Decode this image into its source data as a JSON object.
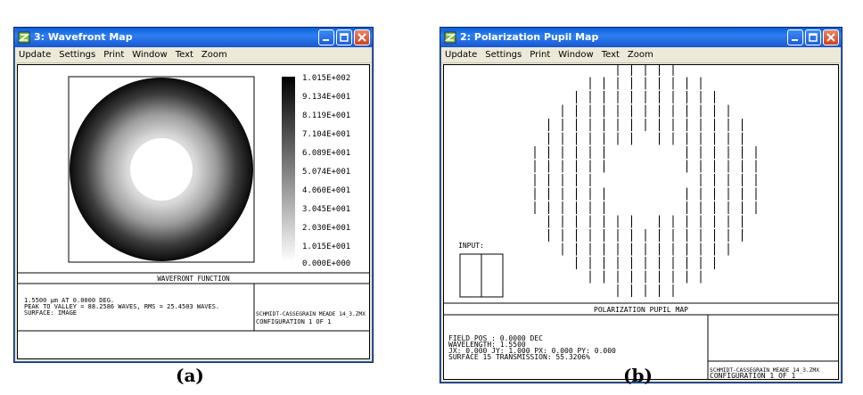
{
  "window_a": {
    "title": "3: Wavefront Map",
    "menu": [
      "Update",
      "Settings",
      "Print",
      "Window",
      "Text",
      "Zoom"
    ],
    "scale_labels": [
      "1.015E+002",
      "9.134E+001",
      "8.119E+001",
      "7.104E+001",
      "6.089E+001",
      "5.074E+001",
      "4.060E+001",
      "3.045E+001",
      "2.030E+001",
      "1.015E+001",
      "0.000E+000"
    ],
    "plot_title": "WAVEFRONT FUNCTION",
    "info_line1": "1.5500 µm AT 0.0000 DEG.",
    "info_line2": "PEAK TO VALLEY = 88.2586 WAVES, RMS = 25.4503 WAVES.",
    "info_line3": "SURFACE: IMAGE",
    "file_name": "SCHMIDT-CASSEGRAIN MEADE 14_3.ZMX",
    "configuration": "CONFIGURATION  1 OF  1"
  },
  "window_b": {
    "title": "2: Polarization Pupil Map",
    "menu": [
      "Update",
      "Settings",
      "Print",
      "Window",
      "Text",
      "Zoom"
    ],
    "input_label": "INPUT:",
    "plot_title": "POLARIZATION PUPIL MAP",
    "info_line1": "FIELD POS   : 0.0000 DEC",
    "info_line2": "WAVELENGTH:   1.5500",
    "info_line3": "JX:  0.000  JY:  1.000  PX:  0.000  PY:  0.000",
    "info_line4": "SURFACE 15 TRANSMISSION: 55.3206%",
    "file_name": "SCHMIDT-CASSEGRAIN MEADE 14_3.ZMX",
    "configuration": "CONFIGURATION  1 OF  1"
  },
  "captions": {
    "a": "(a)",
    "b": "(b)"
  },
  "colors": {
    "titlebar": "#1957d0",
    "close_button": "#d2401c",
    "window_frame": "#ece9d8"
  },
  "icons": {
    "app": "zemax-app-icon",
    "minimize": "minimize-icon",
    "maximize": "maximize-icon",
    "close": "close-icon"
  }
}
